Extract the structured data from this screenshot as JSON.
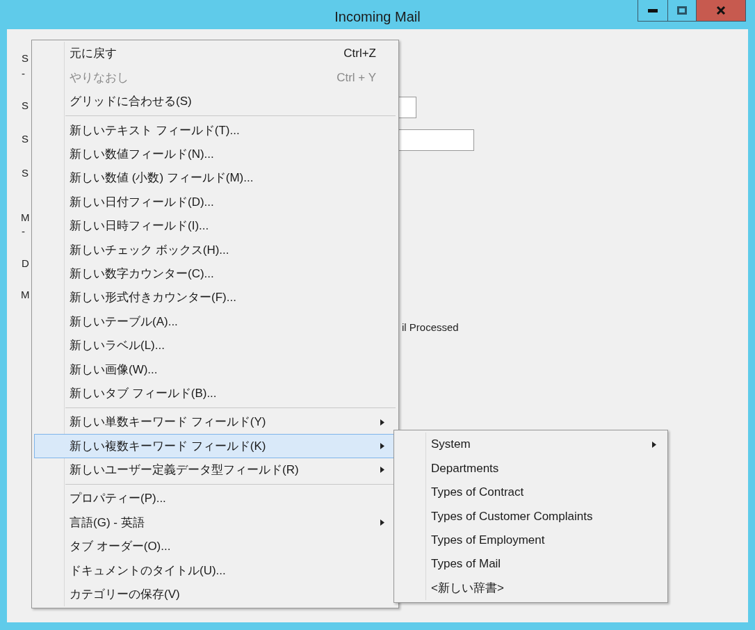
{
  "window": {
    "title": "Incoming Mail"
  },
  "form": {
    "labels": [
      {
        "text": "S"
      },
      {
        "text": "-"
      },
      {
        "text": "S"
      },
      {
        "text": "S"
      },
      {
        "text": "S"
      },
      {
        "text": "M"
      },
      {
        "text": "-"
      },
      {
        "text": "D"
      },
      {
        "text": "M"
      },
      {
        "text": "il Processed"
      }
    ]
  },
  "menu": {
    "groups": [
      [
        {
          "label": "元に戻す",
          "shortcut": "Ctrl+Z",
          "disabled": false,
          "selected": false,
          "has_submenu": false
        },
        {
          "label": "やりなおし",
          "shortcut": "Ctrl + Y",
          "disabled": true,
          "selected": false,
          "has_submenu": false
        },
        {
          "label": "グリッドに合わせる(S)",
          "disabled": false,
          "selected": false,
          "has_submenu": false
        }
      ],
      [
        {
          "label": "新しいテキスト フィールド(T)...",
          "disabled": false,
          "selected": false,
          "has_submenu": false
        },
        {
          "label": "新しい数値フィールド(N)...",
          "disabled": false,
          "selected": false,
          "has_submenu": false
        },
        {
          "label": "新しい数値 (小数) フィールド(M)...",
          "disabled": false,
          "selected": false,
          "has_submenu": false
        },
        {
          "label": "新しい日付フィールド(D)...",
          "disabled": false,
          "selected": false,
          "has_submenu": false
        },
        {
          "label": "新しい日時フィールド(I)...",
          "disabled": false,
          "selected": false,
          "has_submenu": false
        },
        {
          "label": "新しいチェック ボックス(H)...",
          "disabled": false,
          "selected": false,
          "has_submenu": false
        },
        {
          "label": "新しい数字カウンター(C)...",
          "disabled": false,
          "selected": false,
          "has_submenu": false
        },
        {
          "label": "新しい形式付きカウンター(F)...",
          "disabled": false,
          "selected": false,
          "has_submenu": false
        },
        {
          "label": "新しいテーブル(A)...",
          "disabled": false,
          "selected": false,
          "has_submenu": false
        },
        {
          "label": "新しいラベル(L)...",
          "disabled": false,
          "selected": false,
          "has_submenu": false
        },
        {
          "label": "新しい画像(W)...",
          "disabled": false,
          "selected": false,
          "has_submenu": false
        },
        {
          "label": "新しいタブ フィールド(B)...",
          "disabled": false,
          "selected": false,
          "has_submenu": false
        }
      ],
      [
        {
          "label": "新しい単数キーワード フィールド(Y)",
          "disabled": false,
          "selected": false,
          "has_submenu": true
        },
        {
          "label": "新しい複数キーワード フィールド(K)",
          "disabled": false,
          "selected": true,
          "has_submenu": true
        },
        {
          "label": "新しいユーザー定義データ型フィールド(R)",
          "disabled": false,
          "selected": false,
          "has_submenu": true
        }
      ],
      [
        {
          "label": "プロパティー(P)...",
          "disabled": false,
          "selected": false,
          "has_submenu": false
        },
        {
          "label": "言語(G) - 英語",
          "disabled": false,
          "selected": false,
          "has_submenu": true
        },
        {
          "label": "タブ オーダー(O)...",
          "disabled": false,
          "selected": false,
          "has_submenu": false
        },
        {
          "label": "ドキュメントのタイトル(U)...",
          "disabled": false,
          "selected": false,
          "has_submenu": false
        },
        {
          "label": "カテゴリーの保存(V)",
          "disabled": false,
          "selected": false,
          "has_submenu": false
        }
      ]
    ]
  },
  "submenu": {
    "items": [
      {
        "label": "System",
        "has_submenu": true
      },
      {
        "label": "Departments",
        "has_submenu": false
      },
      {
        "label": "Types of Contract",
        "has_submenu": false
      },
      {
        "label": "Types of Customer Complaints",
        "has_submenu": false
      },
      {
        "label": "Types of Employment",
        "has_submenu": false
      },
      {
        "label": "Types of Mail",
        "has_submenu": false
      },
      {
        "label": "<新しい辞書>",
        "has_submenu": false
      }
    ]
  }
}
